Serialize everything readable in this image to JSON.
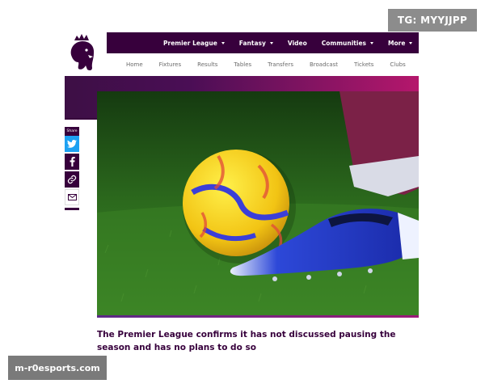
{
  "header": {
    "main_nav": [
      {
        "label": "Premier League",
        "has_dropdown": true
      },
      {
        "label": "Fantasy",
        "has_dropdown": true
      },
      {
        "label": "Video",
        "has_dropdown": false
      },
      {
        "label": "Communities",
        "has_dropdown": true
      },
      {
        "label": "More",
        "has_dropdown": true
      }
    ],
    "sub_nav": [
      "Home",
      "Fixtures",
      "Results",
      "Tables",
      "Transfers",
      "Broadcast",
      "Tickets",
      "Clubs"
    ]
  },
  "share": {
    "label": "Share",
    "buttons": [
      {
        "icon": "twitter-icon"
      },
      {
        "icon": "facebook-icon"
      },
      {
        "icon": "link-icon"
      },
      {
        "icon": "email-icon"
      }
    ]
  },
  "article": {
    "headline": "The Premier League confirms it has not discussed pausing the season and has no plans to do so"
  },
  "overlays": {
    "top_badge": "TG: MYYJJPP",
    "bottom_badge": "m-r0esports.com"
  },
  "colors": {
    "brand_purple": "#37003c",
    "banner_pink": "#b5176c",
    "twitter_blue": "#1da1f2"
  }
}
